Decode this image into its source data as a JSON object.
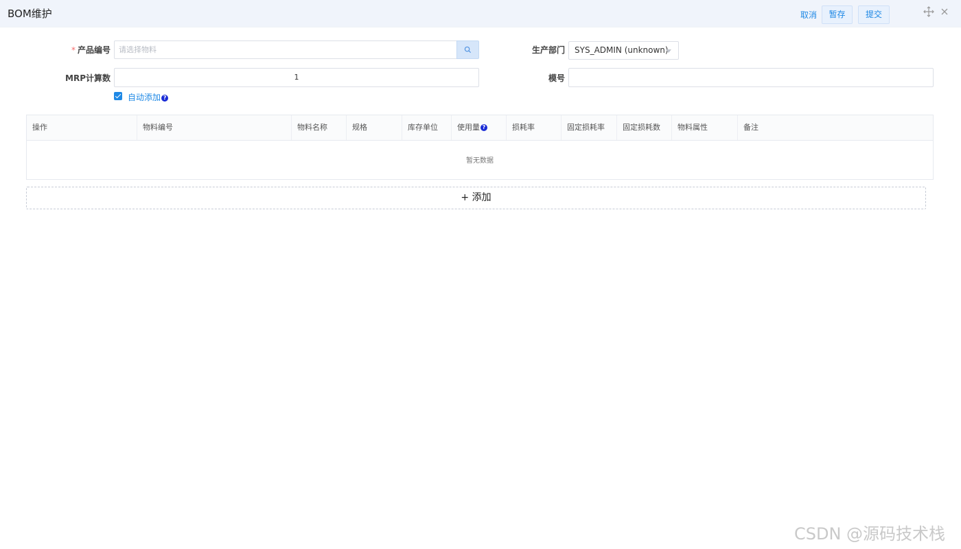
{
  "window": {
    "title": "BOM维护",
    "cancel_label": "取消",
    "save_label": "暂存",
    "submit_label": "提交"
  },
  "form": {
    "product_code": {
      "label": "产品编号",
      "required_mark": "*",
      "placeholder": "请选择物料",
      "value": ""
    },
    "department": {
      "label": "生产部门",
      "value": "SYS_ADMIN (unknown)"
    },
    "mrp_count": {
      "label": "MRP计算数",
      "value": "1"
    },
    "model_no": {
      "label": "模号",
      "value": ""
    },
    "auto_add": {
      "label": "自动添加",
      "checked": true,
      "help": "?"
    }
  },
  "table": {
    "columns": [
      "操作",
      "物料编号",
      "物料名称",
      "规格",
      "库存单位",
      "使用量",
      "损耗率",
      "固定损耗率",
      "固定损耗数",
      "物料属性",
      "备注"
    ],
    "usage_help": "?",
    "empty_text": "暂无数据"
  },
  "add_button": {
    "label": "+ 添加"
  },
  "watermark": "CSDN @源码技术栈",
  "colors": {
    "accent": "#1e88e5",
    "header_bg": "#f0f4fb",
    "required": "#f56c6c"
  },
  "icons": [
    "move-icon",
    "close-icon",
    "search-icon",
    "chevron-down-icon",
    "help-icon",
    "check-icon"
  ]
}
